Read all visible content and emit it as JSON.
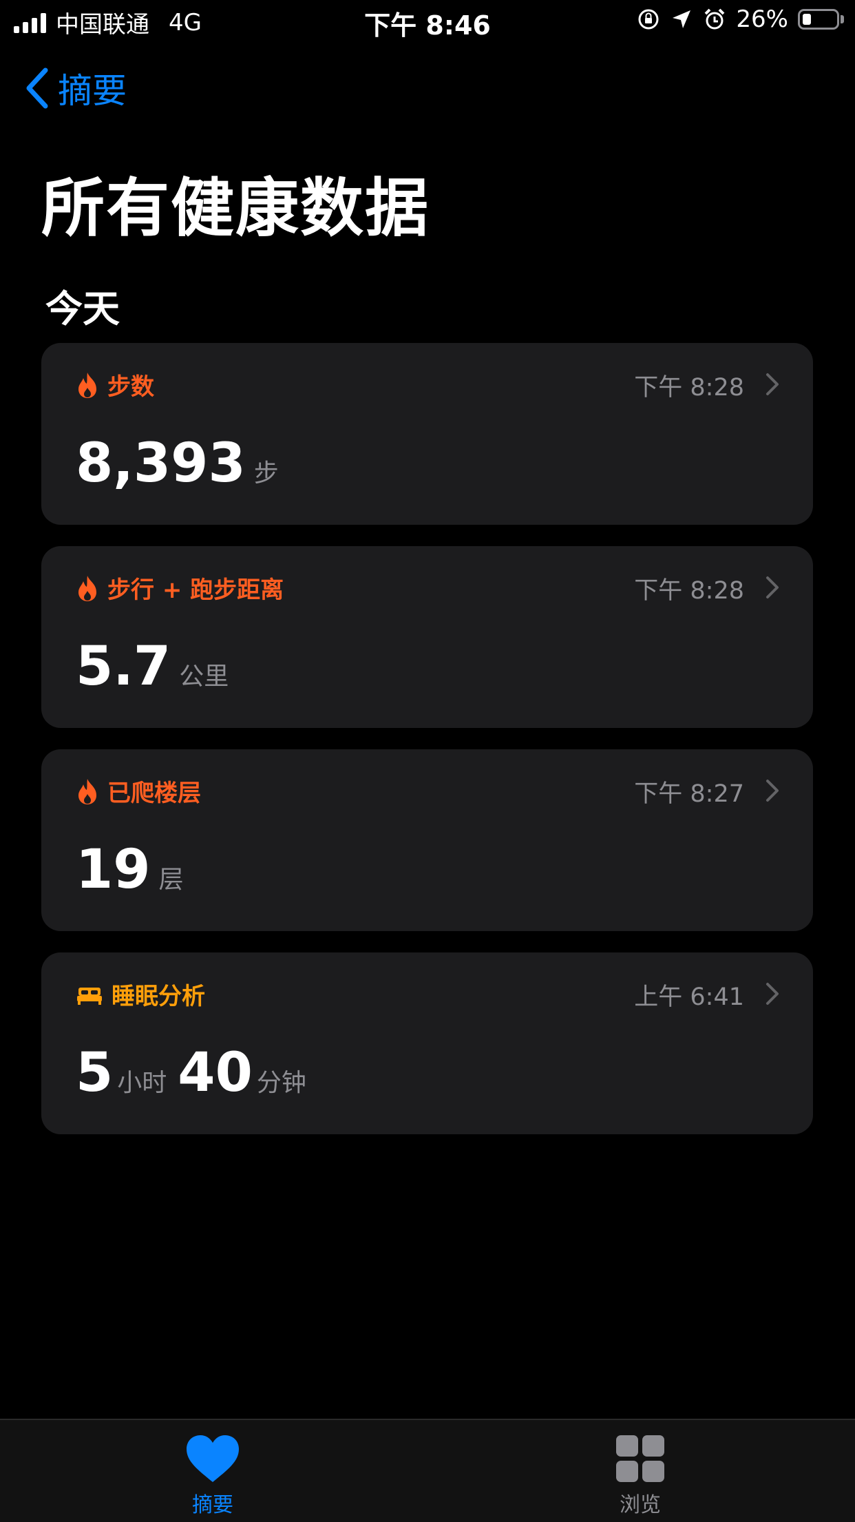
{
  "status_bar": {
    "carrier": "中国联通",
    "network": "4G",
    "time": "下午 8:46",
    "battery_percent": "26%",
    "battery_level": 0.26
  },
  "nav": {
    "back_label": "摘要"
  },
  "page": {
    "title": "所有健康数据",
    "section": "今天"
  },
  "cards": [
    {
      "category": "步数",
      "time": "下午 8:28",
      "icon": "flame-icon",
      "color": "#ff5e21",
      "value": "8,393",
      "unit": "步"
    },
    {
      "category": "步行 + 跑步距离",
      "time": "下午 8:28",
      "icon": "flame-icon",
      "color": "#ff5e21",
      "value": "5.7",
      "unit": "公里"
    },
    {
      "category": "已爬楼层",
      "time": "下午 8:27",
      "icon": "flame-icon",
      "color": "#ff5e21",
      "value": "19",
      "unit": "层"
    },
    {
      "category": "睡眠分析",
      "time": "上午 6:41",
      "icon": "bed-icon",
      "color": "#ff9f0a",
      "value": "5",
      "unit": "小时",
      "value2": "40",
      "unit2": "分钟"
    }
  ],
  "tabs": [
    {
      "label": "摘要",
      "icon": "heart-icon",
      "active": true,
      "color": "#0a84ff"
    },
    {
      "label": "浏览",
      "icon": "grid-icon",
      "active": false,
      "color": "#8e8e93"
    }
  ]
}
